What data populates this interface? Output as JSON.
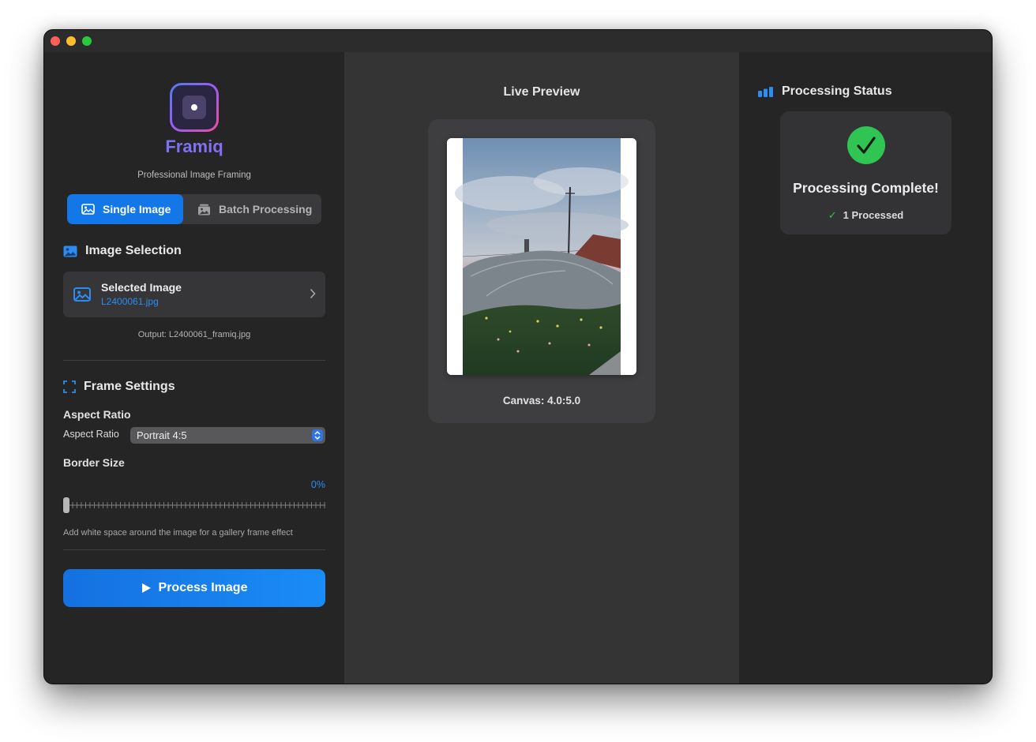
{
  "app": {
    "name": "Framiq",
    "tagline": "Professional Image Framing"
  },
  "mode_tabs": [
    {
      "label": "Single Image",
      "active": true,
      "icon": "photo-icon"
    },
    {
      "label": "Batch Processing",
      "active": false,
      "icon": "photo-stack-icon"
    }
  ],
  "image_selection": {
    "title": "Image Selection",
    "card_label": "Selected Image",
    "file_name": "L2400061.jpg",
    "output": "Output: L2400061_framiq.jpg"
  },
  "frame_settings": {
    "title": "Frame Settings",
    "aspect_ratio_heading": "Aspect Ratio",
    "aspect_ratio_label": "Aspect Ratio",
    "aspect_ratio_value": "Portrait 4:5",
    "border_size_label": "Border Size",
    "border_size_value": "0%",
    "border_size_fraction": 0,
    "hint": "Add white space around the image for a gallery frame effect"
  },
  "process_button": {
    "label": "Process Image",
    "icon": "play-icon"
  },
  "preview": {
    "title": "Live Preview",
    "canvas_caption": "Canvas: 4.0:5.0"
  },
  "status": {
    "title": "Processing Status",
    "message": "Processing Complete!",
    "count": "1 Processed"
  },
  "colors": {
    "accent": "#1477e8",
    "link": "#2b8cf2",
    "success": "#30c453",
    "window_bg": "#262627",
    "preview_bg": "#343435"
  }
}
